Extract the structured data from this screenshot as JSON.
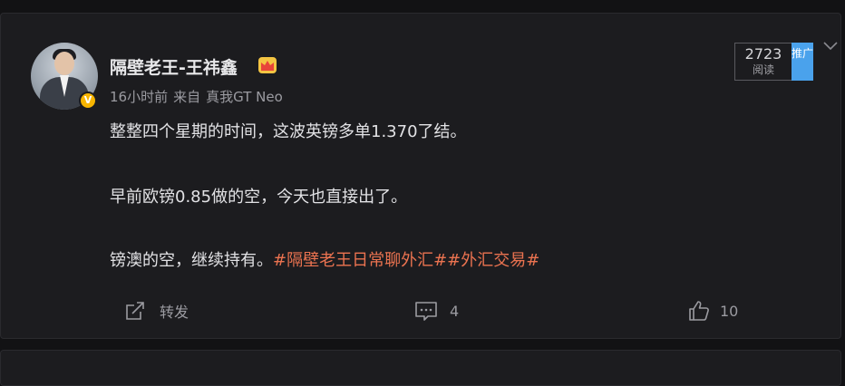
{
  "post": {
    "username": "隔壁老王-王祎鑫",
    "time": "16小时前",
    "source_prefix": "来自",
    "source_device": "真我GT Neo",
    "lines": [
      "整整四个星期的时间，这波英镑多单1.370了结。",
      "早前欧镑0.85做的空，今天也直接出了。",
      "镑澳的空，继续持有。"
    ],
    "hashtags": [
      "#隔壁老王日常聊外汇#",
      "#外汇交易#"
    ],
    "avatar_badge": "V"
  },
  "reads": {
    "count": "2723",
    "label": "阅读",
    "promote_label": "推广"
  },
  "actions": {
    "repost_label": "转发",
    "comment_count": "4",
    "like_count": "10"
  },
  "colors": {
    "background": "#121214",
    "card": "#1c1c1f",
    "hashtag": "#eb7350",
    "promote": "#4aa2ec",
    "verified": "#f7b500"
  }
}
